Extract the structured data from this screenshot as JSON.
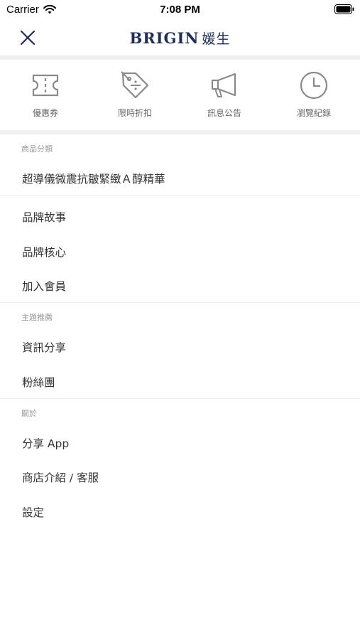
{
  "status_bar": {
    "carrier": "Carrier",
    "time": "7:08 PM"
  },
  "nav": {
    "logo_text": "BRIGIN",
    "logo_cjk": "媛生",
    "brand_color": "#1f2d5a"
  },
  "shortcuts": [
    {
      "label": "優惠券",
      "icon": "ticket-icon"
    },
    {
      "label": "限時折扣",
      "icon": "discount-tag-icon"
    },
    {
      "label": "訊息公告",
      "icon": "megaphone-icon"
    },
    {
      "label": "瀏覽紀錄",
      "icon": "clock-icon"
    }
  ],
  "sections": {
    "category": {
      "header": "商品分類",
      "items": [
        "超導儀微震抗皺緊緻Ａ醇精華"
      ]
    },
    "brand": {
      "items": [
        "品牌故事",
        "品牌核心",
        "加入會員"
      ]
    },
    "topics": {
      "header": "主題推薦",
      "items": [
        "資訊分享",
        "粉絲團"
      ]
    },
    "about": {
      "header": "關於",
      "items": [
        "分享 App",
        "商店介紹 / 客服",
        "設定"
      ]
    }
  }
}
